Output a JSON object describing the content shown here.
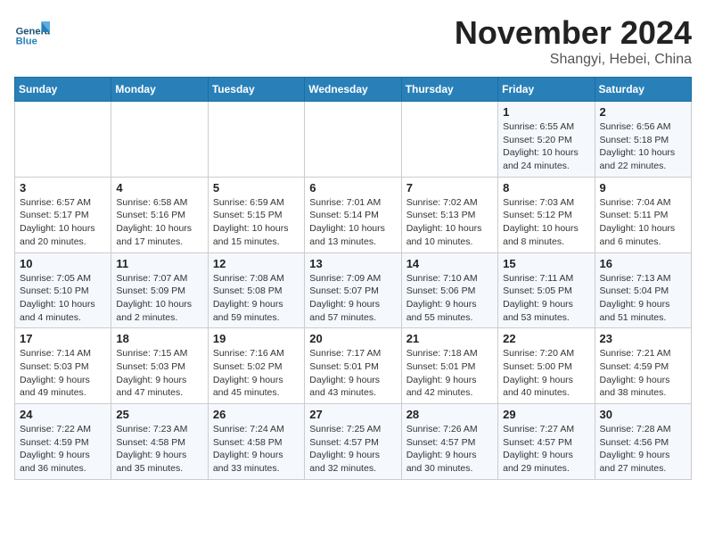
{
  "header": {
    "logo": {
      "general": "General",
      "blue": "Blue"
    },
    "title": "November 2024",
    "subtitle": "Shangyi, Hebei, China"
  },
  "weekdays": [
    "Sunday",
    "Monday",
    "Tuesday",
    "Wednesday",
    "Thursday",
    "Friday",
    "Saturday"
  ],
  "weeks": [
    [
      {
        "day": "",
        "info": ""
      },
      {
        "day": "",
        "info": ""
      },
      {
        "day": "",
        "info": ""
      },
      {
        "day": "",
        "info": ""
      },
      {
        "day": "",
        "info": ""
      },
      {
        "day": "1",
        "info": "Sunrise: 6:55 AM\nSunset: 5:20 PM\nDaylight: 10 hours and 24 minutes."
      },
      {
        "day": "2",
        "info": "Sunrise: 6:56 AM\nSunset: 5:18 PM\nDaylight: 10 hours and 22 minutes."
      }
    ],
    [
      {
        "day": "3",
        "info": "Sunrise: 6:57 AM\nSunset: 5:17 PM\nDaylight: 10 hours and 20 minutes."
      },
      {
        "day": "4",
        "info": "Sunrise: 6:58 AM\nSunset: 5:16 PM\nDaylight: 10 hours and 17 minutes."
      },
      {
        "day": "5",
        "info": "Sunrise: 6:59 AM\nSunset: 5:15 PM\nDaylight: 10 hours and 15 minutes."
      },
      {
        "day": "6",
        "info": "Sunrise: 7:01 AM\nSunset: 5:14 PM\nDaylight: 10 hours and 13 minutes."
      },
      {
        "day": "7",
        "info": "Sunrise: 7:02 AM\nSunset: 5:13 PM\nDaylight: 10 hours and 10 minutes."
      },
      {
        "day": "8",
        "info": "Sunrise: 7:03 AM\nSunset: 5:12 PM\nDaylight: 10 hours and 8 minutes."
      },
      {
        "day": "9",
        "info": "Sunrise: 7:04 AM\nSunset: 5:11 PM\nDaylight: 10 hours and 6 minutes."
      }
    ],
    [
      {
        "day": "10",
        "info": "Sunrise: 7:05 AM\nSunset: 5:10 PM\nDaylight: 10 hours and 4 minutes."
      },
      {
        "day": "11",
        "info": "Sunrise: 7:07 AM\nSunset: 5:09 PM\nDaylight: 10 hours and 2 minutes."
      },
      {
        "day": "12",
        "info": "Sunrise: 7:08 AM\nSunset: 5:08 PM\nDaylight: 9 hours and 59 minutes."
      },
      {
        "day": "13",
        "info": "Sunrise: 7:09 AM\nSunset: 5:07 PM\nDaylight: 9 hours and 57 minutes."
      },
      {
        "day": "14",
        "info": "Sunrise: 7:10 AM\nSunset: 5:06 PM\nDaylight: 9 hours and 55 minutes."
      },
      {
        "day": "15",
        "info": "Sunrise: 7:11 AM\nSunset: 5:05 PM\nDaylight: 9 hours and 53 minutes."
      },
      {
        "day": "16",
        "info": "Sunrise: 7:13 AM\nSunset: 5:04 PM\nDaylight: 9 hours and 51 minutes."
      }
    ],
    [
      {
        "day": "17",
        "info": "Sunrise: 7:14 AM\nSunset: 5:03 PM\nDaylight: 9 hours and 49 minutes."
      },
      {
        "day": "18",
        "info": "Sunrise: 7:15 AM\nSunset: 5:03 PM\nDaylight: 9 hours and 47 minutes."
      },
      {
        "day": "19",
        "info": "Sunrise: 7:16 AM\nSunset: 5:02 PM\nDaylight: 9 hours and 45 minutes."
      },
      {
        "day": "20",
        "info": "Sunrise: 7:17 AM\nSunset: 5:01 PM\nDaylight: 9 hours and 43 minutes."
      },
      {
        "day": "21",
        "info": "Sunrise: 7:18 AM\nSunset: 5:01 PM\nDaylight: 9 hours and 42 minutes."
      },
      {
        "day": "22",
        "info": "Sunrise: 7:20 AM\nSunset: 5:00 PM\nDaylight: 9 hours and 40 minutes."
      },
      {
        "day": "23",
        "info": "Sunrise: 7:21 AM\nSunset: 4:59 PM\nDaylight: 9 hours and 38 minutes."
      }
    ],
    [
      {
        "day": "24",
        "info": "Sunrise: 7:22 AM\nSunset: 4:59 PM\nDaylight: 9 hours and 36 minutes."
      },
      {
        "day": "25",
        "info": "Sunrise: 7:23 AM\nSunset: 4:58 PM\nDaylight: 9 hours and 35 minutes."
      },
      {
        "day": "26",
        "info": "Sunrise: 7:24 AM\nSunset: 4:58 PM\nDaylight: 9 hours and 33 minutes."
      },
      {
        "day": "27",
        "info": "Sunrise: 7:25 AM\nSunset: 4:57 PM\nDaylight: 9 hours and 32 minutes."
      },
      {
        "day": "28",
        "info": "Sunrise: 7:26 AM\nSunset: 4:57 PM\nDaylight: 9 hours and 30 minutes."
      },
      {
        "day": "29",
        "info": "Sunrise: 7:27 AM\nSunset: 4:57 PM\nDaylight: 9 hours and 29 minutes."
      },
      {
        "day": "30",
        "info": "Sunrise: 7:28 AM\nSunset: 4:56 PM\nDaylight: 9 hours and 27 minutes."
      }
    ]
  ]
}
